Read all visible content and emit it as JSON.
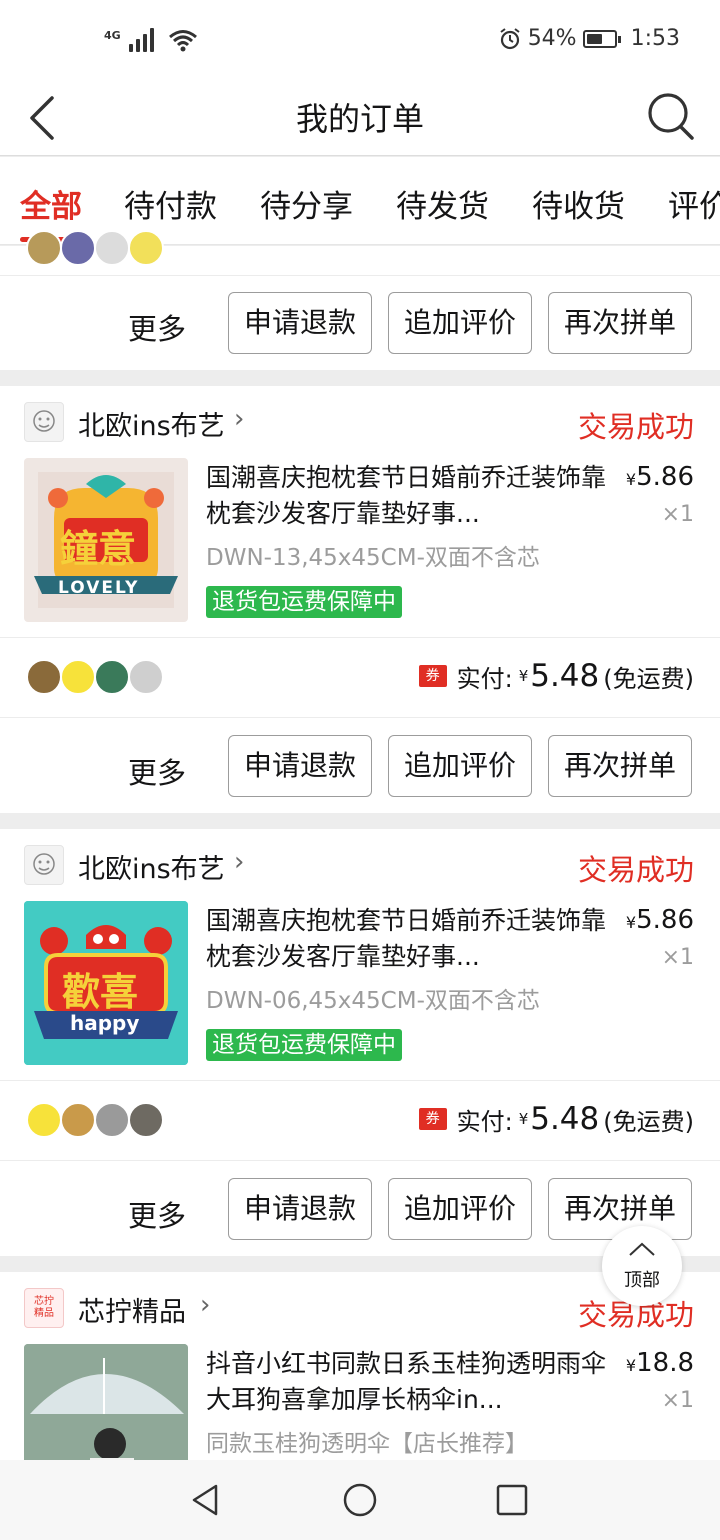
{
  "status_bar": {
    "network": "4G",
    "battery_pct": "54%",
    "time": "1:53"
  },
  "header": {
    "title": "我的订单"
  },
  "tabs": [
    {
      "label": "全部",
      "active": true
    },
    {
      "label": "待付款"
    },
    {
      "label": "待分享"
    },
    {
      "label": "待发货"
    },
    {
      "label": "待收货"
    },
    {
      "label": "评价"
    }
  ],
  "actions": {
    "more": "更多",
    "refund": "申请退款",
    "review": "追加评价",
    "rebuy": "再次拼单"
  },
  "orders": [
    {
      "shop": "北欧ins布艺",
      "status": "交易成功",
      "product_title": "国潮喜庆抱枕套节日婚前乔迁装饰靠枕套沙发客厅靠垫好事...",
      "price": "5.86",
      "qty": "×1",
      "spec": "DWN-13,45x45CM-双面不含芯",
      "badge": "退货包运费保障中",
      "thumb_text": "鐘意",
      "thumb_banner": "LOVELY",
      "coupon": "券",
      "paid_label": "实付:",
      "paid_amount": "5.48",
      "shipping": "(免运费)"
    },
    {
      "shop": "北欧ins布艺",
      "status": "交易成功",
      "product_title": "国潮喜庆抱枕套节日婚前乔迁装饰靠枕套沙发客厅靠垫好事...",
      "price": "5.86",
      "qty": "×1",
      "spec": "DWN-06,45x45CM-双面不含芯",
      "badge": "退货包运费保障中",
      "thumb_text": "歡喜",
      "thumb_banner": "happy",
      "coupon": "券",
      "paid_label": "实付:",
      "paid_amount": "5.48",
      "shipping": "(免运费)"
    },
    {
      "shop": "芯拧精品",
      "shop_logo_text": "芯拧精品",
      "status": "交易成功",
      "product_title": "抖音小红书同款日系玉桂狗透明雨伞大耳狗喜拿加厚长柄伞in...",
      "price": "18.8",
      "qty": "×1",
      "spec": "同款玉桂狗透明伞【店长推荐】"
    }
  ],
  "currency": "¥",
  "back_to_top": "顶部",
  "colors": {
    "accent": "#e02e24",
    "green_badge": "#2db84d"
  }
}
